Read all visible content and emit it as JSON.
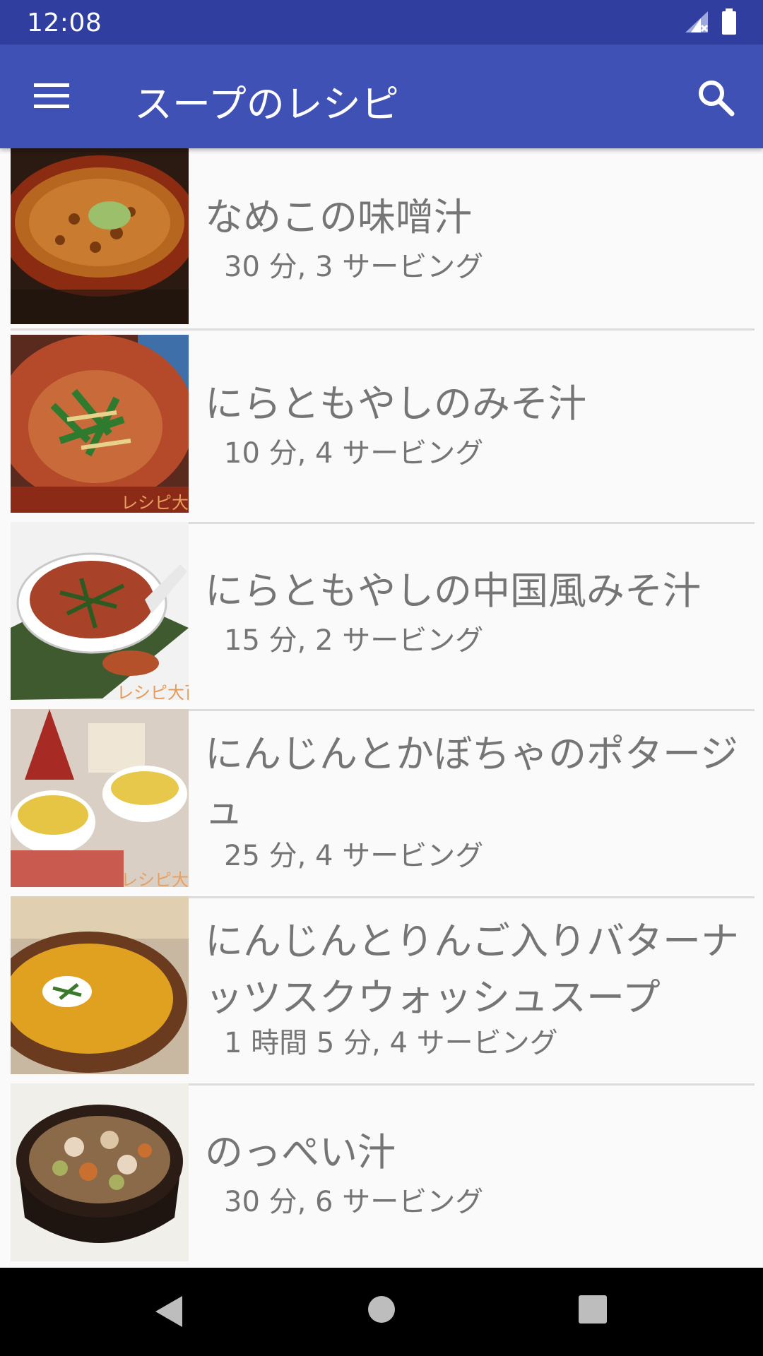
{
  "status_bar": {
    "time": "12:08"
  },
  "app_bar": {
    "title": "スープのレシピ"
  },
  "recipes": [
    {
      "title": "なめこの味噌汁",
      "subtitle": "30 分, 3 サービング"
    },
    {
      "title": "にらともやしのみそ汁",
      "subtitle": "10 分, 4 サービング"
    },
    {
      "title": "にらともやしの中国風みそ汁",
      "subtitle": "15 分, 2 サービング"
    },
    {
      "title": "にんじんとかぼちゃのポタージュ",
      "subtitle": "25 分, 4 サービング"
    },
    {
      "title": "にんじんとりんご入りバターナッツスクウォッシュスープ",
      "subtitle": "1 時間 5 分, 4 サービング"
    },
    {
      "title": "のっぺい汁",
      "subtitle": "30 分, 6 サービング"
    }
  ],
  "thumbnail_watermark": "レシピ大百"
}
